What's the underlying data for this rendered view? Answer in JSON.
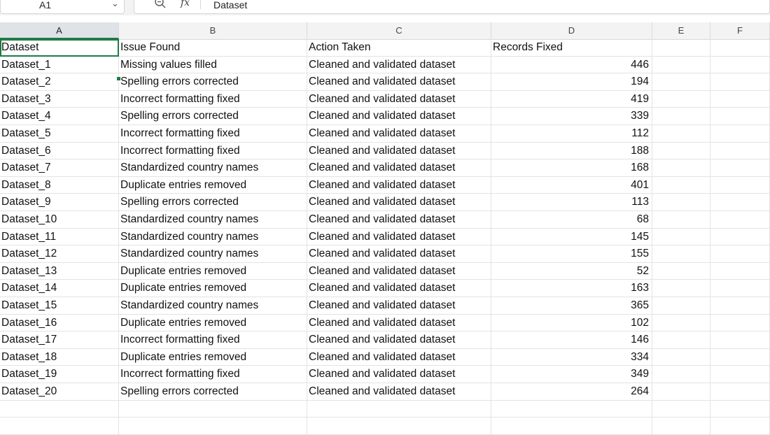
{
  "formula_bar": {
    "name_box": "A1",
    "formula": "Dataset"
  },
  "columns": [
    "A",
    "B",
    "C",
    "D",
    "E",
    "F"
  ],
  "rows": [
    [
      "Dataset",
      "Issue Found",
      "Action Taken",
      "Records Fixed"
    ],
    [
      "Dataset_1",
      "Missing values filled",
      "Cleaned and validated dataset",
      "446"
    ],
    [
      "Dataset_2",
      "Spelling errors corrected",
      "Cleaned and validated dataset",
      "194"
    ],
    [
      "Dataset_3",
      "Incorrect formatting fixed",
      "Cleaned and validated dataset",
      "419"
    ],
    [
      "Dataset_4",
      "Spelling errors corrected",
      "Cleaned and validated dataset",
      "339"
    ],
    [
      "Dataset_5",
      "Incorrect formatting fixed",
      "Cleaned and validated dataset",
      "112"
    ],
    [
      "Dataset_6",
      "Incorrect formatting fixed",
      "Cleaned and validated dataset",
      "188"
    ],
    [
      "Dataset_7",
      "Standardized country names",
      "Cleaned and validated dataset",
      "168"
    ],
    [
      "Dataset_8",
      "Duplicate entries removed",
      "Cleaned and validated dataset",
      "401"
    ],
    [
      "Dataset_9",
      "Spelling errors corrected",
      "Cleaned and validated dataset",
      "113"
    ],
    [
      "Dataset_10",
      "Standardized country names",
      "Cleaned and validated dataset",
      "68"
    ],
    [
      "Dataset_11",
      "Standardized country names",
      "Cleaned and validated dataset",
      "145"
    ],
    [
      "Dataset_12",
      "Standardized country names",
      "Cleaned and validated dataset",
      "155"
    ],
    [
      "Dataset_13",
      "Duplicate entries removed",
      "Cleaned and validated dataset",
      "52"
    ],
    [
      "Dataset_14",
      "Duplicate entries removed",
      "Cleaned and validated dataset",
      "163"
    ],
    [
      "Dataset_15",
      "Standardized country names",
      "Cleaned and validated dataset",
      "365"
    ],
    [
      "Dataset_16",
      "Duplicate entries removed",
      "Cleaned and validated dataset",
      "102"
    ],
    [
      "Dataset_17",
      "Incorrect formatting fixed",
      "Cleaned and validated dataset",
      "146"
    ],
    [
      "Dataset_18",
      "Duplicate entries removed",
      "Cleaned and validated dataset",
      "334"
    ],
    [
      "Dataset_19",
      "Incorrect formatting fixed",
      "Cleaned and validated dataset",
      "349"
    ],
    [
      "Dataset_20",
      "Spelling errors corrected",
      "Cleaned and validated dataset",
      "264"
    ]
  ],
  "selected_cell": "A1",
  "colors": {
    "selection": "#1e7b45",
    "header_bg": "#f3f3f3",
    "gridline": "#e3e3e3"
  }
}
